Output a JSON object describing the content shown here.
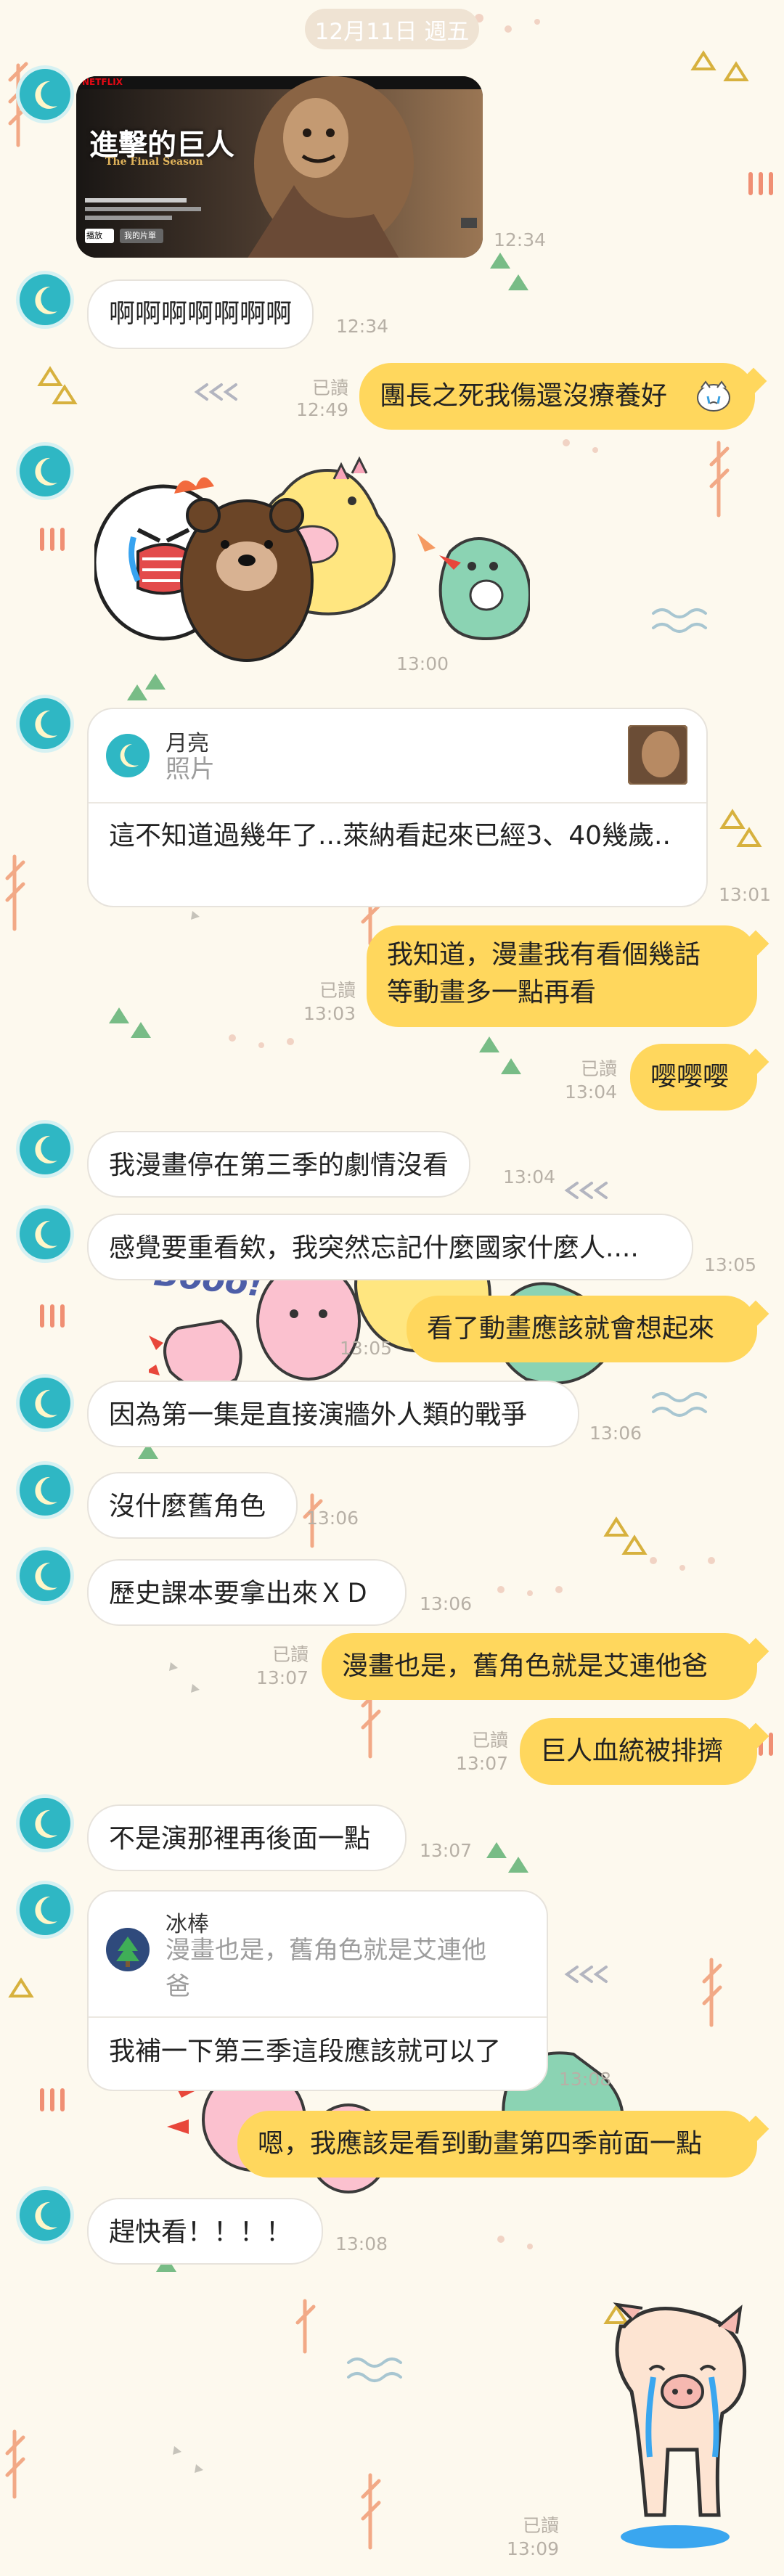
{
  "header": {
    "date": "12月11日 週五"
  },
  "media_post": {
    "brand": "NETFLIX",
    "title": "進擊的巨人",
    "subtitle": "The Final Season",
    "play_label": "播放",
    "list_label": "我的片單",
    "time": "12:34"
  },
  "messages": [
    {
      "id": "m1",
      "text": "啊啊啊啊啊啊啊",
      "time": "12:34"
    },
    {
      "id": "m2",
      "text": "團長之死我傷還沒療養好",
      "read": "已讀",
      "time": "12:49"
    },
    {
      "id": "m3",
      "time": "13:00"
    },
    {
      "id": "m4",
      "quote_name": "月亮",
      "quote_text": "照片",
      "text": "這不知道過幾年了...萊納看起來已經3、40幾歲..",
      "time": "13:01"
    },
    {
      "id": "m5",
      "line1": "我知道，漫畫我有看個幾話",
      "line2": "等動畫多一點再看",
      "read": "已讀",
      "time": "13:03"
    },
    {
      "id": "m6",
      "text": "嘤嘤嘤",
      "read": "已讀",
      "time": "13:04"
    },
    {
      "id": "m7",
      "text": "我漫畫停在第三季的劇情沒看",
      "time": "13:04"
    },
    {
      "id": "m8",
      "text": "感覺要重看欸，我突然忘記什麼國家什麼人....",
      "time": "13:05"
    },
    {
      "id": "m9",
      "text": "看了動畫應該就會想起來",
      "time": "13:05"
    },
    {
      "id": "m10",
      "text": "因為第一集是直接演牆外人類的戰爭",
      "time": "13:06"
    },
    {
      "id": "m11",
      "text": "沒什麼舊角色",
      "time": "13:06"
    },
    {
      "id": "m12",
      "text": "歷史課本要拿出來ＸＤ",
      "time": "13:06"
    },
    {
      "id": "m13",
      "text": "漫畫也是，舊角色就是艾連他爸",
      "read": "已讀",
      "time": "13:07"
    },
    {
      "id": "m14",
      "text": "巨人血統被排擠",
      "read": "已讀",
      "time": "13:07"
    },
    {
      "id": "m15",
      "text": "不是演那裡再後面一點",
      "time": "13:07"
    },
    {
      "id": "m16",
      "quote_name": "冰棒",
      "quote_line1": "漫畫也是，舊角色就是艾連他",
      "quote_line2": "爸",
      "text": "我補一下第三季這段應該就可以了",
      "time": "13:08"
    },
    {
      "id": "m17",
      "text": "嗯，我應該是看到動畫第四季前面一點"
    },
    {
      "id": "m18",
      "text": "趕快看！！！！",
      "time": "13:08"
    },
    {
      "id": "m19",
      "read": "已讀",
      "time": "13:09"
    }
  ],
  "sticker_text": "Booo!",
  "colors": {
    "background": "#fdf9ee",
    "my_bubble": "#ffd75d",
    "their_bubble": "#ffffff",
    "avatar": "#2fb7c4",
    "date_pill": "#efe3d3"
  }
}
